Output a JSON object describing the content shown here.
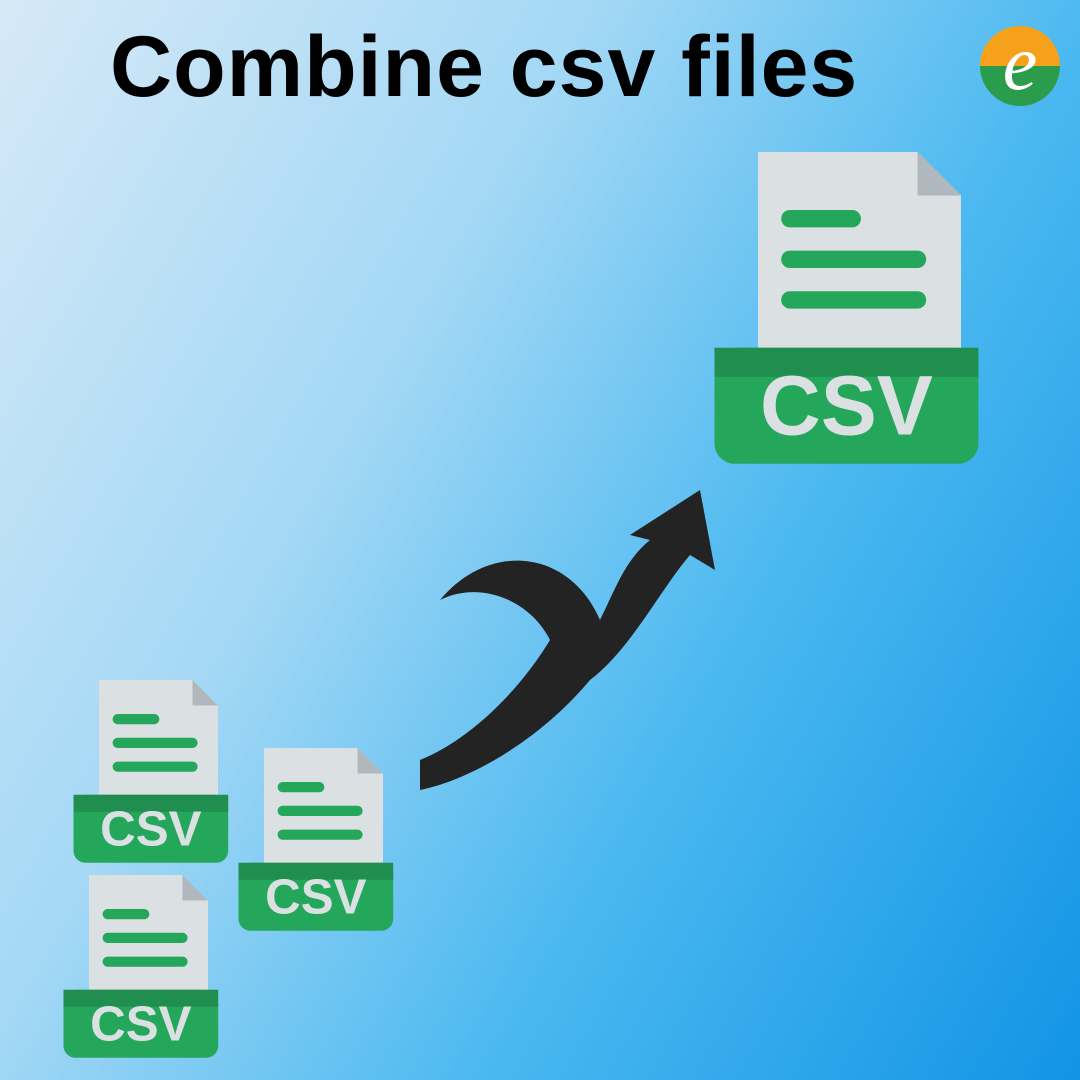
{
  "title": "Combine csv files",
  "icons": {
    "csv_label": "CSV"
  }
}
